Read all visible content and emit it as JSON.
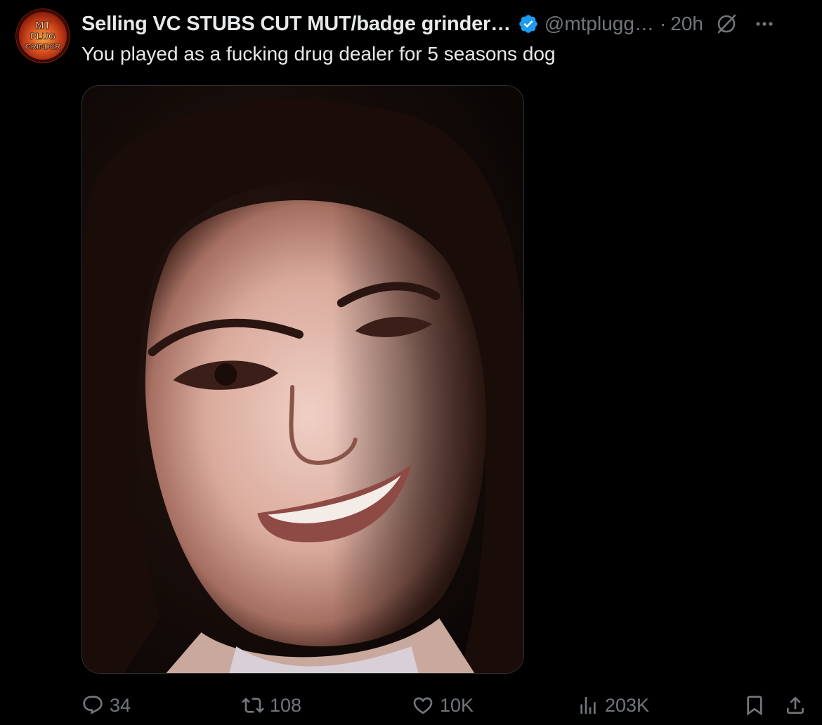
{
  "post": {
    "author": {
      "display_name": "Selling VC STUBS CUT MUT/badge grinder…",
      "handle": "@mtplugg…",
      "verified": true,
      "avatar_text": [
        "MT",
        "PLUG",
        "GRINDER"
      ]
    },
    "separator": "·",
    "time": "20h",
    "text": "You played as a fucking drug dealer for 5 seasons dog",
    "media": {
      "type": "photo"
    }
  },
  "actions": {
    "replies": "34",
    "reposts": "108",
    "likes": "10K",
    "views": "203K"
  },
  "icons": {
    "verified": "verified-badge-icon",
    "grok": "grok-icon",
    "more": "more-options-icon",
    "reply": "reply-icon",
    "repost": "repost-icon",
    "like": "heart-icon",
    "views": "views-chart-icon",
    "bookmark": "bookmark-icon",
    "share": "share-icon"
  },
  "colors": {
    "background": "#000000",
    "primary_text": "#e7e9ea",
    "secondary_text": "#71767b",
    "verified_blue": "#1d9bf0",
    "border": "#2f3336"
  }
}
